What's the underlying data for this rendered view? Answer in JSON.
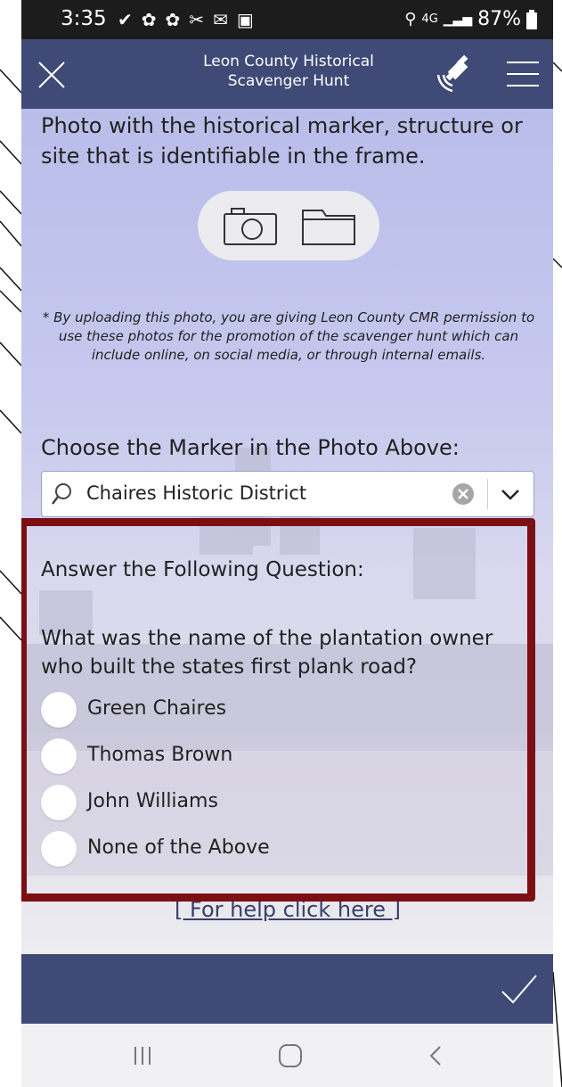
{
  "status": {
    "time": "3:35",
    "battery": "87%",
    "icons": [
      "check-circle-icon",
      "sync-icon",
      "sync-icon",
      "tools-icon",
      "mail-icon",
      "image-icon"
    ],
    "right_icons": [
      "location-icon",
      "signal-4g-icon",
      "signal-bars-icon",
      "battery-icon"
    ]
  },
  "header": {
    "title_line1": "Leon County Historical",
    "title_line2": "Scavenger Hunt"
  },
  "intro": "Photo with the historical marker, structure or site that is identifiable in the frame.",
  "disclaimer": "* By uploading this photo, you are giving Leon County CMR permission to use these photos for the promotion of the scavenger hunt which can include online, on social media, or through internal emails.",
  "marker": {
    "label": "Choose the Marker in the Photo Above:",
    "selected": "Chaires Historic District"
  },
  "question": {
    "section_label": "Answer the Following Question:",
    "text": "What was the name of the plantation owner who built the states first plank road?",
    "options": [
      {
        "label": "Green Chaires"
      },
      {
        "label": "Thomas Brown"
      },
      {
        "label": "John Williams"
      },
      {
        "label": "None of the Above"
      }
    ]
  },
  "help": "[ For help click here ]",
  "colors": {
    "appbar": "#3f4a76",
    "highlight_frame": "#7b0f14"
  }
}
